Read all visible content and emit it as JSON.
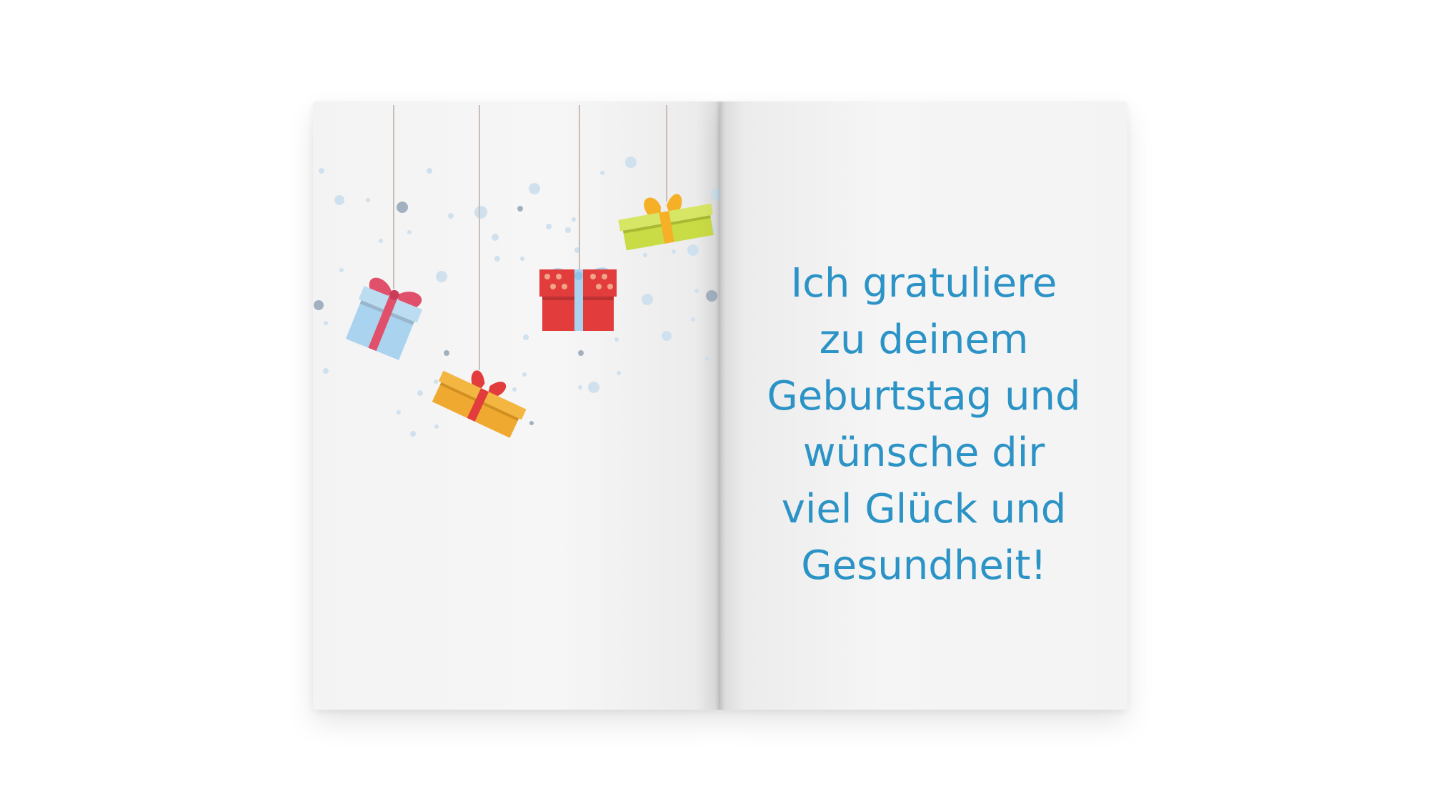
{
  "greeting": {
    "lines": [
      "Ich gratuliere",
      "zu deinem",
      "Geburtstag und",
      "wünsche dir",
      "viel Glück und",
      "Gesundheit!"
    ]
  },
  "colors": {
    "text": "#2b93c6",
    "string": "#c9bdb6",
    "gift_blue": "#a9d3ef",
    "gift_red": "#e23c3c",
    "gift_orange": "#f0a930",
    "gift_lime": "#c9dc45",
    "ribbon_pink": "#e0506a",
    "ribbon_light_blue": "#a9d3ef",
    "ribbon_orange": "#f5b027",
    "ribbon_red": "#e23c3c",
    "dot_light": "#cfe1ee",
    "dot_dark": "#a2b1c0"
  },
  "illustration": {
    "icons": [
      "gift-box-blue-icon",
      "gift-box-red-dotted-icon",
      "gift-box-orange-icon",
      "gift-box-lime-icon"
    ]
  }
}
